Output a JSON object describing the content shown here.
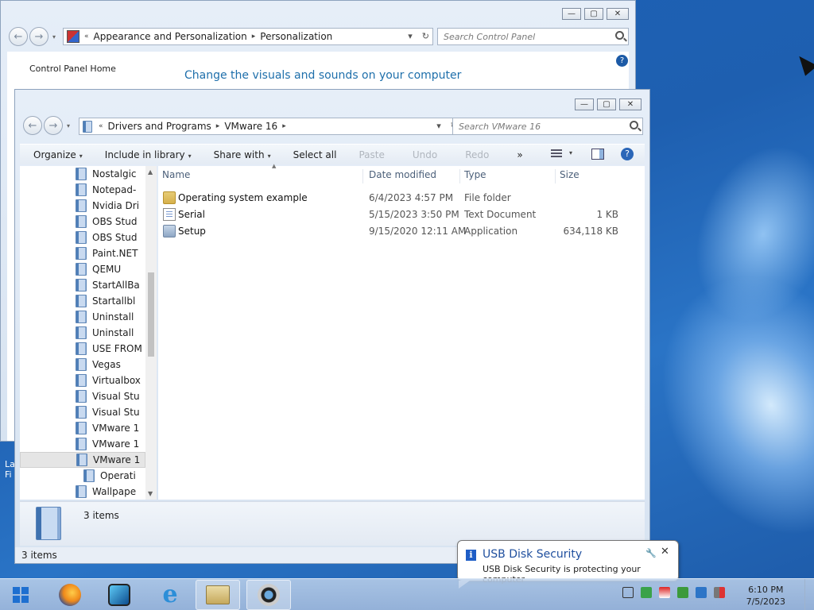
{
  "control_panel": {
    "breadcrumb": [
      "Appearance and Personalization",
      "Personalization"
    ],
    "search_placeholder": "Search Control Panel",
    "sidebar_link": "Control Panel Home",
    "heading": "Change the visuals and sounds on your computer",
    "help_glyph": "?"
  },
  "explorer": {
    "breadcrumb": [
      "Drivers and Programs",
      "VMware 16"
    ],
    "search_placeholder": "Search VMware 16",
    "toolbar": {
      "organize": "Organize",
      "include_in_library": "Include in library",
      "share_with": "Share with",
      "select_all": "Select all",
      "paste": "Paste",
      "undo": "Undo",
      "redo": "Redo",
      "more": "»"
    },
    "tree_items": [
      "Nostalgic",
      "Notepad-",
      "Nvidia Dri",
      "OBS Stud",
      "OBS Stud",
      "Paint.NET",
      "QEMU",
      "StartAllBa",
      "Startallbl",
      "Uninstall",
      "Uninstall",
      "USE FROM",
      "Vegas",
      "Virtualbox",
      "Visual Stu",
      "Visual Stu",
      "VMware 1",
      "VMware 1",
      "VMware 1",
      "Operati",
      "Wallpape"
    ],
    "columns": {
      "name": "Name",
      "date": "Date modified",
      "type": "Type",
      "size": "Size"
    },
    "files": [
      {
        "name": "Operating system example",
        "date": "6/4/2023 4:57 PM",
        "type": "File folder",
        "size": ""
      },
      {
        "name": "Serial",
        "date": "5/15/2023 3:50 PM",
        "type": "Text Document",
        "size": "1 KB"
      },
      {
        "name": "Setup",
        "date": "9/15/2020 12:11 AM",
        "type": "Application",
        "size": "634,118 KB"
      }
    ],
    "details_count": "3 items",
    "status_text": "3 items"
  },
  "desktop_fragment": {
    "line1": "La",
    "line2": "Fi"
  },
  "notification": {
    "title": "USB Disk Security",
    "message": "USB Disk Security is protecting your computer"
  },
  "clock": {
    "time": "6:10 PM",
    "date": "7/5/2023"
  }
}
